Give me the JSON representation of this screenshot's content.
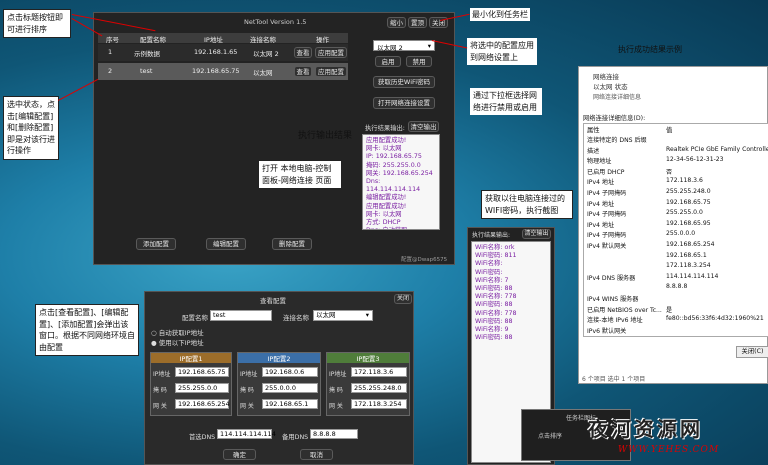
{
  "annotations": {
    "sort": "点击标题按钮即可进行排序",
    "select": "选中状态，点击[编辑配置]和[删除配置]即是对该行进行操作",
    "minimize": "最小化到任务栏",
    "apply": "将选中的配置应用到网络设置上",
    "dropdown": "通过下拉框选择网络进行禁用或启用",
    "result_example": "执行成功结果示例",
    "output": "执行输出结果",
    "open_panel": "打开 本地电脑-控制面板-网络连接 页面",
    "wifi": "获取以往电脑连接过的WIFI密码，执行截图",
    "dialog": "点击[查看配置]、[编辑配置]、[添加配置]会弹出该窗口。根据不同网络环境自由配置"
  },
  "main": {
    "title": "NetTool Version 1.5",
    "minimize": "缩小",
    "topmost": "置顶",
    "close": "关闭",
    "headers": [
      "序号",
      "配置名称",
      "IP地址",
      "连接名称",
      "操作"
    ],
    "rows": [
      {
        "no": "1",
        "name": "示例数据",
        "ip": "192.168.1.65",
        "conn": "以太网 2",
        "view": "查看",
        "apply": "应用配置"
      },
      {
        "no": "2",
        "name": "test",
        "ip": "192.168.65.75",
        "conn": "以太网",
        "view": "查看",
        "apply": "应用配置"
      }
    ],
    "adapter": "以太网 2",
    "enable": "启用",
    "disable": "禁用",
    "wifi_btn": "获取历史WiFi密码",
    "netset_btn": "打开网络连接设置",
    "output_label": "执行结果输出:",
    "clear": "清空输出",
    "output_lines": [
      "应用配置成功!",
      "网卡: 以太网",
      "IP: 192.168.65.75",
      "掩码: 255.255.0.0",
      "网关: 192.168.65.254",
      "Dns: 114.114.114.114",
      "编辑配置成功!",
      "应用配置成功!",
      "网卡: 以太网",
      "方式: DHCP",
      "Dns: 自动获取"
    ],
    "add": "添加配置",
    "edit": "编辑配置",
    "delete": "删除配置",
    "footer": "配置@Dwap6575"
  },
  "wifi": {
    "label": "执行结果输出:",
    "clear": "清空输出",
    "lines": [
      "WiFi名称: ork",
      "WiFi密码: 811",
      "WiFi名称: ",
      "WiFi密码: ",
      "WiFi名称: 7",
      "WiFi密码: 88",
      "WiFi名称: 778",
      "WiFi密码: 88",
      "WiFi名称: 778",
      "WiFi密码: 88",
      "WiFi名称: 9",
      "WiFi密码: 88"
    ]
  },
  "netwin": {
    "title": "网络连接",
    "sub": "以太网 状态",
    "detail_title": "网络连接详细信息",
    "detail_label": "网络连接详细信息(D):",
    "hdr_prop": "属性",
    "hdr_val": "值",
    "rows": [
      [
        "连接特定的 DNS 后缀",
        ""
      ],
      [
        "描述",
        "Realtek PCIe GbE Family Controller"
      ],
      [
        "物理地址",
        "12-34-56-12-31-23"
      ],
      [
        "已启用 DHCP",
        "否"
      ],
      [
        "IPv4 地址",
        "172.118.3.6"
      ],
      [
        "IPv4 子网掩码",
        "255.255.248.0"
      ],
      [
        "IPv4 地址",
        "192.168.65.75"
      ],
      [
        "IPv4 子网掩码",
        "255.255.0.0"
      ],
      [
        "IPv4 地址",
        "192.168.65.95"
      ],
      [
        "IPv4 子网掩码",
        "255.0.0.0"
      ],
      [
        "IPv4 默认网关",
        "192.168.65.254"
      ],
      [
        "",
        "192.168.65.1"
      ],
      [
        "",
        "172.118.3.254"
      ],
      [
        "IPv4 DNS 服务器",
        "114.114.114.114"
      ],
      [
        "",
        "8.8.8.8"
      ],
      [
        "IPv4 WINS 服务器",
        ""
      ],
      [
        "已启用 NetBIOS over Tc...",
        "是"
      ],
      [
        "连接-本地 IPv6 地址",
        "fe80::bd56:33f6:4d32:1960%21"
      ],
      [
        "IPv6 默认网关",
        ""
      ]
    ],
    "close": "关闭(C)",
    "status": "6 个项目    选中 1 个项目"
  },
  "dialog": {
    "title": "查看配置",
    "close": "关闭",
    "name_label": "配置名称",
    "name": "test",
    "conn_label": "连接名称",
    "conn": "以太网",
    "auto": "自动获取IP地址",
    "manual": "使用以下IP地址",
    "groups": [
      {
        "title": "IP配置1",
        "ip": "192.168.65.75",
        "mask": "255.255.0.0",
        "gw": "192.168.65.254"
      },
      {
        "title": "IP配置2",
        "ip": "192.168.0.6",
        "mask": "255.0.0.0",
        "gw": "192.168.65.1"
      },
      {
        "title": "IP配置3",
        "ip": "172.118.3.6",
        "mask": "255.255.248.0",
        "gw": "172.118.3.254"
      }
    ],
    "ip_label": "IP地址",
    "mask_label": "掩 码",
    "gw_label": "网 关",
    "dns1_label": "首选DNS",
    "dns1": "114.114.114.114",
    "dns2_label": "备用DNS",
    "dns2": "8.8.8.8",
    "ok": "确定",
    "cancel": "取消"
  },
  "watermark": {
    "text": "夜河资源网",
    "url": "WWW.YEHES.COM",
    "small": "任务栏图标",
    "small2": "点击排序"
  },
  "colors": {
    "accent": "#d00000",
    "purple": "#7a1fa2",
    "header": "#3d3d3d",
    "selected": "#5a5a5a"
  }
}
